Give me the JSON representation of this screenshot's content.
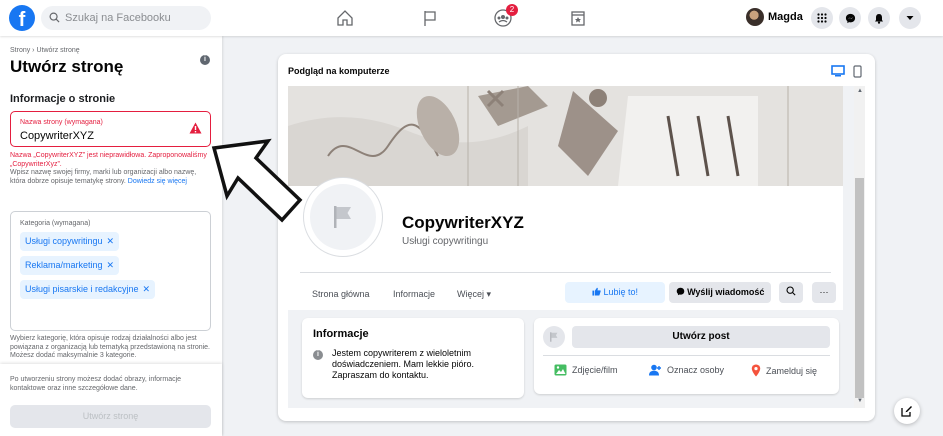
{
  "topbar": {
    "logo": "f",
    "search_placeholder": "Szukaj na Facebooku",
    "groups_badge": "2",
    "profile_name": "Magda"
  },
  "left": {
    "breadcrumb": "Strony › Utwórz stronę",
    "title": "Utwórz stronę",
    "section_title": "Informacje o stronie",
    "name_field": {
      "label": "Nazwa strony (wymagana)",
      "value": "CopywriterXYZ"
    },
    "error_text": "Nazwa „CopywriterXYZ” jest nieprawidłowa. Zaproponowaliśmy „CopywriterXyz”.",
    "help_text": "Wpisz nazwę swojej firmy, marki lub organizacji albo nazwę, która dobrze opisuje tematykę strony.",
    "help_link": "Dowiedz się więcej",
    "category_field": {
      "label": "Kategoria (wymagana)",
      "chips": [
        "Usługi copywritingu",
        "Reklama/marketing",
        "Usługi pisarskie i redakcyjne"
      ],
      "remove_glyph": "✕"
    },
    "category_help": "Wybierz kategorię, która opisuje rodzaj działalności albo jest powiązana z organizacją lub tematyką przedstawioną na stronie. Możesz dodać maksymalnie 3 kategorie.",
    "bottom_note": "Po utworzeniu strony możesz dodać obrazy, informacje kontaktowe oraz inne szczegółowe dane.",
    "create_button": "Utwórz stronę"
  },
  "preview": {
    "label": "Podgląd na komputerze",
    "page_name": "CopywriterXYZ",
    "page_category": "Usługi copywritingu",
    "tabs": [
      "Strona główna",
      "Informacje",
      "Więcej ▾"
    ],
    "like_button": "Lubię to!",
    "message_button": "Wyślij wiadomość",
    "more_button": "···",
    "info_card": {
      "heading": "Informacje",
      "text": "Jestem copywriterem z wieloletnim doświadczeniem. Mam lekkie pióro. Zapraszam do kontaktu."
    },
    "post_card": {
      "create_post": "Utwórz post",
      "actions": [
        "Zdjęcie/film",
        "Oznacz osoby",
        "Zamelduj się"
      ]
    }
  },
  "colors": {
    "brand": "#1877f2",
    "error": "#e41e3f",
    "chip_bg": "#e7f3ff"
  }
}
